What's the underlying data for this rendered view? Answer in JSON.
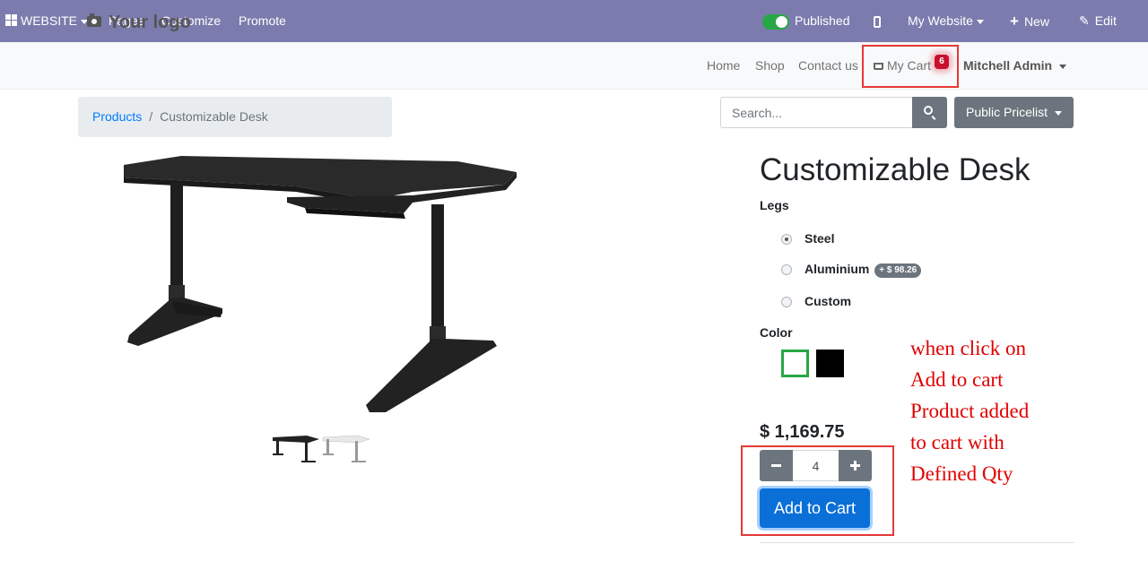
{
  "admin_bar": {
    "website_label": "WEBSITE",
    "pages_label": "Pages",
    "customize_label": "Customize",
    "promote_label": "Promote",
    "published_label": "Published",
    "my_website_label": "My Website",
    "new_label": "New",
    "edit_label": "Edit"
  },
  "header": {
    "logo_text": "Your logo",
    "nav": [
      "Home",
      "Shop",
      "Contact us"
    ],
    "cart_label": "My Cart",
    "cart_count": "6",
    "user_name": "Mitchell Admin"
  },
  "breadcrumb": {
    "items": [
      "Products",
      "Customizable Desk"
    ],
    "separator": "/"
  },
  "search": {
    "placeholder": "Search..."
  },
  "pricelist_label": "Public Pricelist",
  "product": {
    "title": "Customizable Desk",
    "legs_label": "Legs",
    "legs_options": [
      {
        "label": "Steel",
        "selected": true,
        "extra": ""
      },
      {
        "label": "Aluminium",
        "selected": false,
        "extra": "+ $ 98.26"
      },
      {
        "label": "Custom",
        "selected": false,
        "extra": ""
      }
    ],
    "color_label": "Color",
    "colors": [
      {
        "name": "white",
        "hex": "#ffffff",
        "selected": true
      },
      {
        "name": "black",
        "hex": "#000000",
        "selected": false
      }
    ],
    "price": "$ 1,169.75",
    "quantity": "4",
    "add_to_cart_label": "Add to Cart"
  },
  "annotation": {
    "lines": [
      "when click on",
      "Add to cart",
      "Product added",
      "to cart with",
      "Defined Qty"
    ]
  },
  "colors": {
    "admin_bar": "#7c7bad",
    "primary": "#0b6fd8",
    "secondary": "#6c757d",
    "highlight": "#e53935",
    "published_toggle": "#28a745"
  }
}
